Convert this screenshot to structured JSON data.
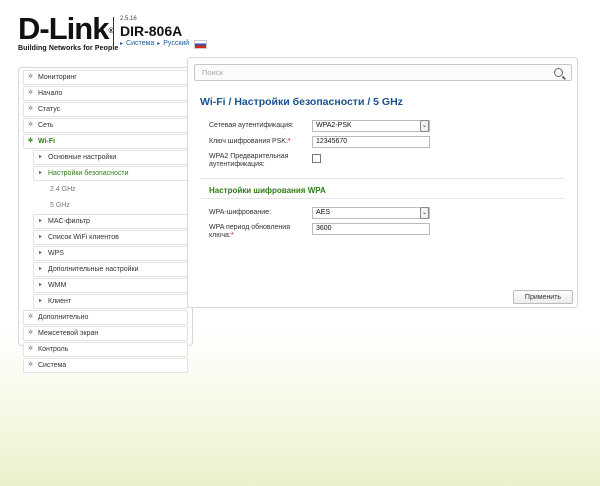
{
  "header": {
    "logo_text": "D-Link",
    "logo_reg": "®",
    "tagline": "Building Networks for People",
    "firmware": "2.5.16",
    "model": "DIR-806A",
    "crumb_system": "Система",
    "crumb_language": "Русский"
  },
  "search": {
    "placeholder": "Поиск"
  },
  "sidebar": {
    "items": [
      {
        "label": "Мониторинг",
        "icon": "gear-icon"
      },
      {
        "label": "Начало",
        "icon": "gear-icon"
      },
      {
        "label": "Статус",
        "icon": "gear-icon"
      },
      {
        "label": "Сеть",
        "icon": "gear-icon"
      },
      {
        "label": "Wi-Fi",
        "icon": "gear-icon"
      },
      {
        "label": "Основные настройки",
        "icon": "triangle-right-icon"
      },
      {
        "label": "Настройки безопасности",
        "icon": "triangle-right-icon"
      },
      {
        "label": "2.4 GHz"
      },
      {
        "label": "5 GHz"
      },
      {
        "label": "MAC-фильтр",
        "icon": "triangle-right-icon"
      },
      {
        "label": "Список WiFi клиентов",
        "icon": "triangle-right-icon"
      },
      {
        "label": "WPS",
        "icon": "triangle-right-icon"
      },
      {
        "label": "Дополнительные настройки",
        "icon": "triangle-right-icon"
      },
      {
        "label": "WMM",
        "icon": "triangle-right-icon"
      },
      {
        "label": "Клиент",
        "icon": "triangle-right-icon"
      },
      {
        "label": "Дополнительно",
        "icon": "gear-icon"
      },
      {
        "label": "Межсетевой экран",
        "icon": "gear-icon"
      },
      {
        "label": "Контроль",
        "icon": "gear-icon"
      },
      {
        "label": "Система",
        "icon": "gear-icon"
      }
    ]
  },
  "main": {
    "title": "Wi-Fi /  Настройки безопасности /  5 GHz",
    "auth_label": "Сетевая аутентификация:",
    "auth_value": "WPA2-PSK",
    "psk_label": "Ключ шифрования PSK:",
    "psk_req": "*",
    "psk_value": "12345670",
    "preauth_label": "WPA2 Предварительная аутентификация:",
    "wpa_section": "Настройки шифрования WPA",
    "cipher_label": "WPA-шифрование:",
    "cipher_value": "AES",
    "period_label": "WPA период обновления ключа:",
    "period_req": "*",
    "period_value": "3600",
    "apply_label": "Применить"
  },
  "colors": {
    "accent": "#1a5191",
    "active": "#2e7d17",
    "link": "#1a5fa3"
  }
}
